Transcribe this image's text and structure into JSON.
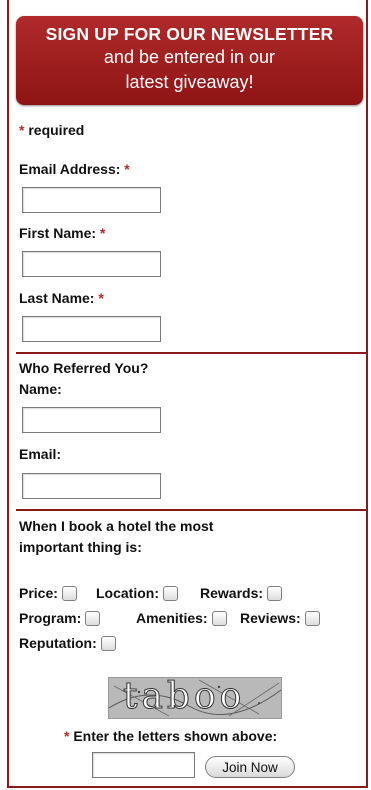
{
  "banner": {
    "line1": "SIGN UP FOR OUR NEWSLETTER",
    "line2": "and be entered in our",
    "line3": "latest giveaway!"
  },
  "required_note": {
    "star": "*",
    "text": " required"
  },
  "fields": {
    "email_label": "Email Address:",
    "first_name_label": "First Name:",
    "last_name_label": "Last Name:",
    "required_star": "*"
  },
  "referral": {
    "heading": "Who Referred You?",
    "name_label": "Name:",
    "email_label": "Email:"
  },
  "preferences": {
    "question_line1": "When I book a hotel the most",
    "question_line2": "important thing is:",
    "options": [
      "Price:",
      "Location:",
      "Rewards:",
      "Program:",
      "Amenities:",
      "Reviews:",
      "Reputation:"
    ]
  },
  "captcha": {
    "image_text": "taboo",
    "instruction": "Enter the letters shown above:",
    "star": "*"
  },
  "submit_label": "Join Now",
  "colors": {
    "accent": "#8b1a1a",
    "banner": "#a32222"
  }
}
